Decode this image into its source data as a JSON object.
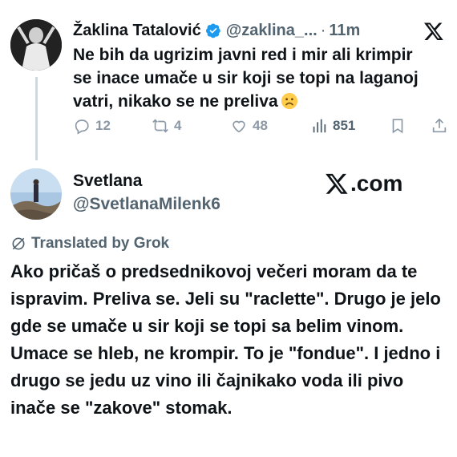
{
  "tweet1": {
    "author_name": "Žaklina Tatalović",
    "handle": "@zaklina_...",
    "separator": "·",
    "time": "11m",
    "text": "Ne bih da ugrizim javni red i mir ali krimpir se inace umače u sir koji se topi na laganoj vatri, nikako se ne preliva",
    "emoji": "slightly-frowning-face",
    "reply_count": "12",
    "repost_count": "4",
    "like_count": "48",
    "view_count": "851"
  },
  "tweet2": {
    "author_name": "Svetlana",
    "handle": "@SvetlanaMilenk6",
    "translated_label": "Translated by Grok",
    "text": "Ako pričaš o predsednikovoj večeri moram da te ispravim. Preliva se. Jeli su \"raclette\". Drugo je jelo gde se umače u sir koji se topi sa belim vinom. Umace se hleb, ne krompir. To je \"fondue\". I jedno i drugo se jedu uz vino ili čajnikako voda ili pivo inače se \"zakove\" stomak."
  },
  "watermark": {
    "text": ".com"
  },
  "colors": {
    "text": "#0f1419",
    "muted": "#536471",
    "verified": "#1d9bf0",
    "icon": "#8b98a5"
  }
}
